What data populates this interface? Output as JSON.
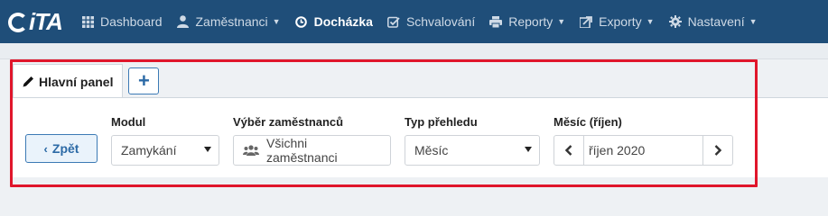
{
  "app": {
    "logo_text": "iTA"
  },
  "nav": {
    "items": [
      {
        "label": "Dashboard",
        "icon": "grid-icon",
        "caret": false,
        "active": false
      },
      {
        "label": "Zaměstnanci",
        "icon": "user-icon",
        "caret": true,
        "active": false
      },
      {
        "label": "Docházka",
        "icon": "clock-icon",
        "caret": false,
        "active": true
      },
      {
        "label": "Schvalování",
        "icon": "check-square-icon",
        "caret": false,
        "active": false
      },
      {
        "label": "Reporty",
        "icon": "print-icon",
        "caret": true,
        "active": false
      },
      {
        "label": "Exporty",
        "icon": "export-icon",
        "caret": true,
        "active": false
      },
      {
        "label": "Nastavení",
        "icon": "gear-icon",
        "caret": true,
        "active": false
      }
    ]
  },
  "tabs": {
    "main_label": "Hlavní panel",
    "add_label": "+"
  },
  "filters": {
    "back_label": "Zpět",
    "module": {
      "label": "Modul",
      "value": "Zamykání"
    },
    "employees": {
      "label": "Výběr zaměstnanců",
      "value": "Všichni zaměstnanci"
    },
    "overview": {
      "label": "Typ přehledu",
      "value": "Měsíc"
    },
    "month": {
      "label": "Měsíc (říjen)",
      "value": "říjen 2020"
    }
  },
  "colors": {
    "navbar": "#1f4e79",
    "accent": "#2c6aa6",
    "highlight": "#e0162b"
  }
}
